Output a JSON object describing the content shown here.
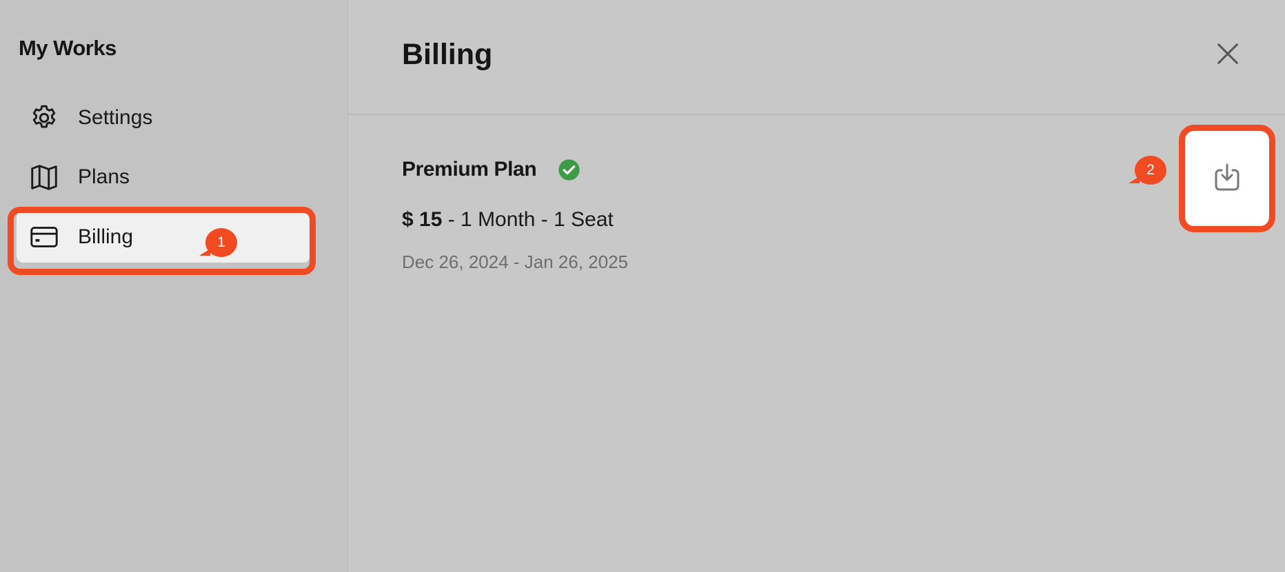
{
  "sidebar": {
    "title": "My Works",
    "items": [
      {
        "label": "Settings",
        "icon": "gear-icon"
      },
      {
        "label": "Plans",
        "icon": "map-icon"
      },
      {
        "label": "Billing",
        "icon": "credit-card-icon",
        "selected": true
      }
    ]
  },
  "main": {
    "title": "Billing",
    "close_icon": "close-icon",
    "plan": {
      "name": "Premium Plan",
      "status_icon": "check-circle-icon",
      "price": "$ 15",
      "terms": " - 1 Month - 1 Seat",
      "date_range": "Dec 26, 2024 - Jan 26, 2025"
    },
    "download_icon": "download-icon"
  },
  "annotations": {
    "marker_1": "1",
    "marker_2": "2",
    "color": "#f04b23"
  },
  "colors": {
    "sidebar_bg": "#c3c3c3",
    "main_bg": "#c8c8c8",
    "selected_bg": "#f0f0f0",
    "check_green": "#3d9a45",
    "accent_red": "#f04b23"
  }
}
